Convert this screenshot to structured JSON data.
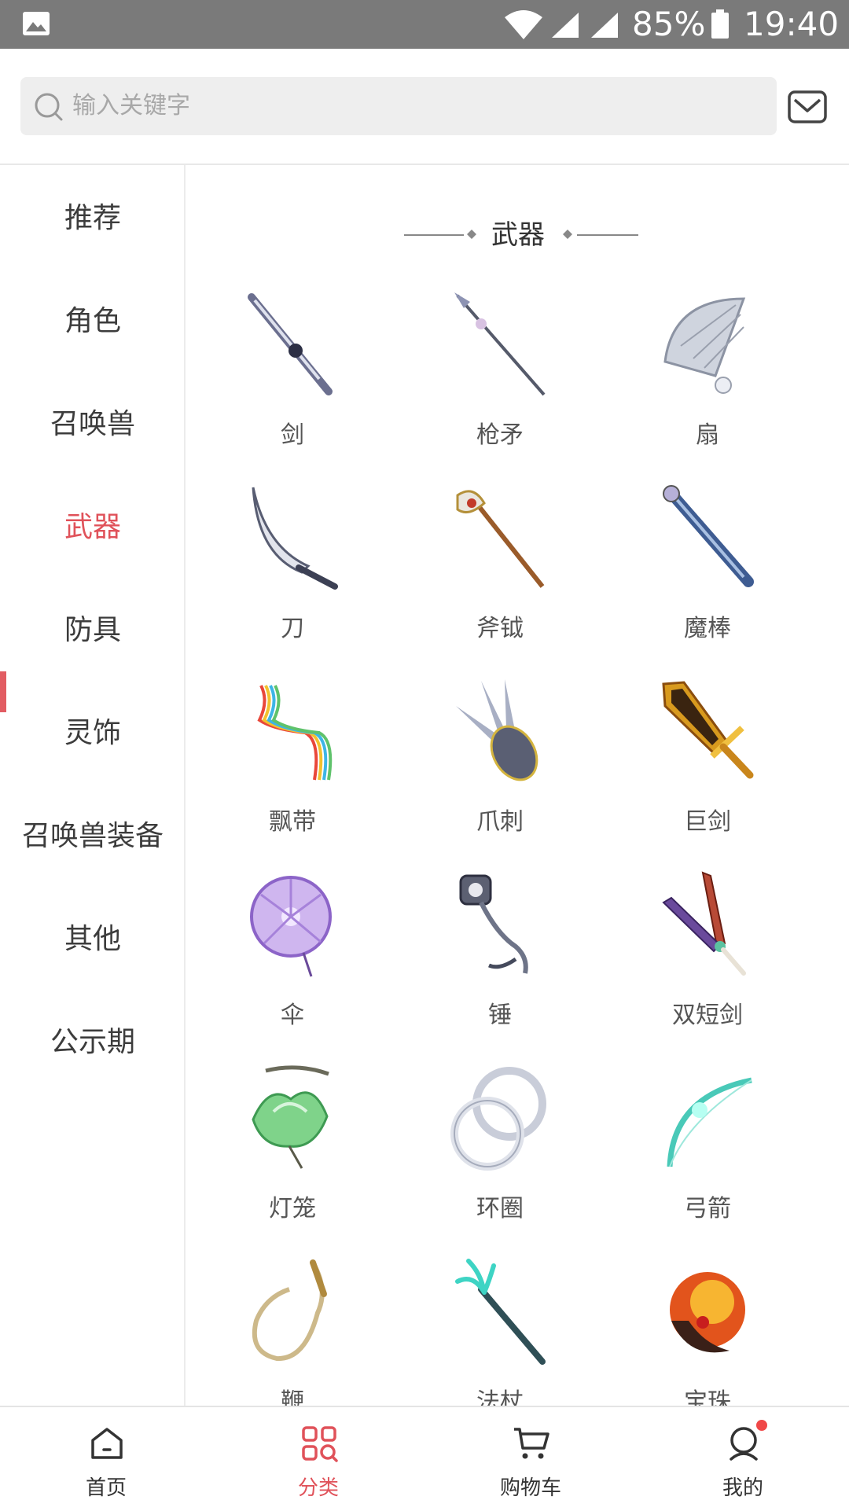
{
  "status_bar": {
    "battery_percent": "85%",
    "time": "19:40"
  },
  "search": {
    "placeholder": "输入关键字"
  },
  "sidebar": {
    "items": [
      {
        "label": "推荐"
      },
      {
        "label": "角色"
      },
      {
        "label": "召唤兽"
      },
      {
        "label": "武器",
        "active": true
      },
      {
        "label": "防具"
      },
      {
        "label": "灵饰"
      },
      {
        "label": "召唤兽装备"
      },
      {
        "label": "其他"
      },
      {
        "label": "公示期"
      }
    ]
  },
  "content": {
    "section_title": "武器",
    "items": [
      {
        "label": "剑",
        "icon": "sword-icon"
      },
      {
        "label": "枪矛",
        "icon": "spear-icon"
      },
      {
        "label": "扇",
        "icon": "fan-icon"
      },
      {
        "label": "刀",
        "icon": "blade-icon"
      },
      {
        "label": "斧钺",
        "icon": "axe-icon"
      },
      {
        "label": "魔棒",
        "icon": "wand-icon"
      },
      {
        "label": "飘带",
        "icon": "ribbon-icon"
      },
      {
        "label": "爪刺",
        "icon": "claw-icon"
      },
      {
        "label": "巨剑",
        "icon": "greatsword-icon"
      },
      {
        "label": "伞",
        "icon": "umbrella-icon"
      },
      {
        "label": "锤",
        "icon": "hammer-icon"
      },
      {
        "label": "双短剑",
        "icon": "dual-daggers-icon"
      },
      {
        "label": "灯笼",
        "icon": "lantern-icon"
      },
      {
        "label": "环圈",
        "icon": "rings-icon"
      },
      {
        "label": "弓箭",
        "icon": "bow-icon"
      },
      {
        "label": "鞭",
        "icon": "whip-icon"
      },
      {
        "label": "法杖",
        "icon": "staff-icon"
      },
      {
        "label": "宝珠",
        "icon": "orb-icon"
      }
    ]
  },
  "bottom_nav": {
    "items": [
      {
        "label": "首页",
        "icon": "home-icon"
      },
      {
        "label": "分类",
        "icon": "category-icon",
        "active": true
      },
      {
        "label": "购物车",
        "icon": "cart-icon"
      },
      {
        "label": "我的",
        "icon": "profile-icon",
        "has_notification": true
      }
    ]
  },
  "colors": {
    "accent": "#e0525a",
    "status_bar": "#7a7a7a"
  }
}
